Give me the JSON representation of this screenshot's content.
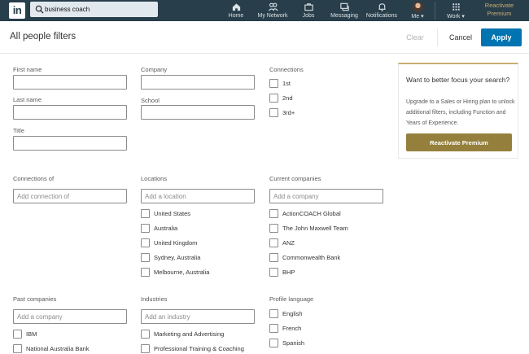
{
  "topnav": {
    "search_value": "business coach",
    "home": "Home",
    "network": "My Network",
    "jobs": "Jobs",
    "messaging": "Messaging",
    "notifications": "Notifications",
    "me": "Me",
    "work": "Work",
    "premium_line1": "Reactivate",
    "premium_line2": "Premium"
  },
  "header": {
    "title": "All people filters",
    "clear": "Clear",
    "cancel": "Cancel",
    "apply": "Apply"
  },
  "filters": {
    "first_name": "First name",
    "last_name": "Last name",
    "title": "Title",
    "company": "Company",
    "school": "School",
    "connections": {
      "label": "Connections",
      "options": [
        "1st",
        "2nd",
        "3rd+"
      ]
    },
    "connections_of": {
      "label": "Connections of",
      "placeholder": "Add connection of"
    },
    "locations": {
      "label": "Locations",
      "placeholder": "Add a location",
      "options": [
        "United States",
        "Australia",
        "United Kingdom",
        "Sydney, Australia",
        "Melbourne, Australia"
      ]
    },
    "current_companies": {
      "label": "Current companies",
      "placeholder": "Add a company",
      "options": [
        "ActionCOACH Global",
        "The John Maxwell Team",
        "ANZ",
        "Commonwealth Bank",
        "BHP"
      ]
    },
    "past_companies": {
      "label": "Past companies",
      "placeholder": "Add a company",
      "options": [
        "IBM",
        "National Australia Bank"
      ]
    },
    "industries": {
      "label": "Industries",
      "placeholder": "Add an industry",
      "options": [
        "Marketing and Advertising",
        "Professional Training & Coaching"
      ]
    },
    "profile_language": {
      "label": "Profile language",
      "options": [
        "English",
        "French",
        "Spanish"
      ]
    }
  },
  "upsell": {
    "heading": "Want to better focus your search?",
    "body": "Upgrade to a Sales or Hiring plan to unlock additional filters, including Function and Years of Experience.",
    "button": "Reactivate Premium"
  },
  "colors": {
    "nav_bg": "#283e4a",
    "apply_blue": "#0073b1",
    "premium_gold": "#94803c"
  }
}
